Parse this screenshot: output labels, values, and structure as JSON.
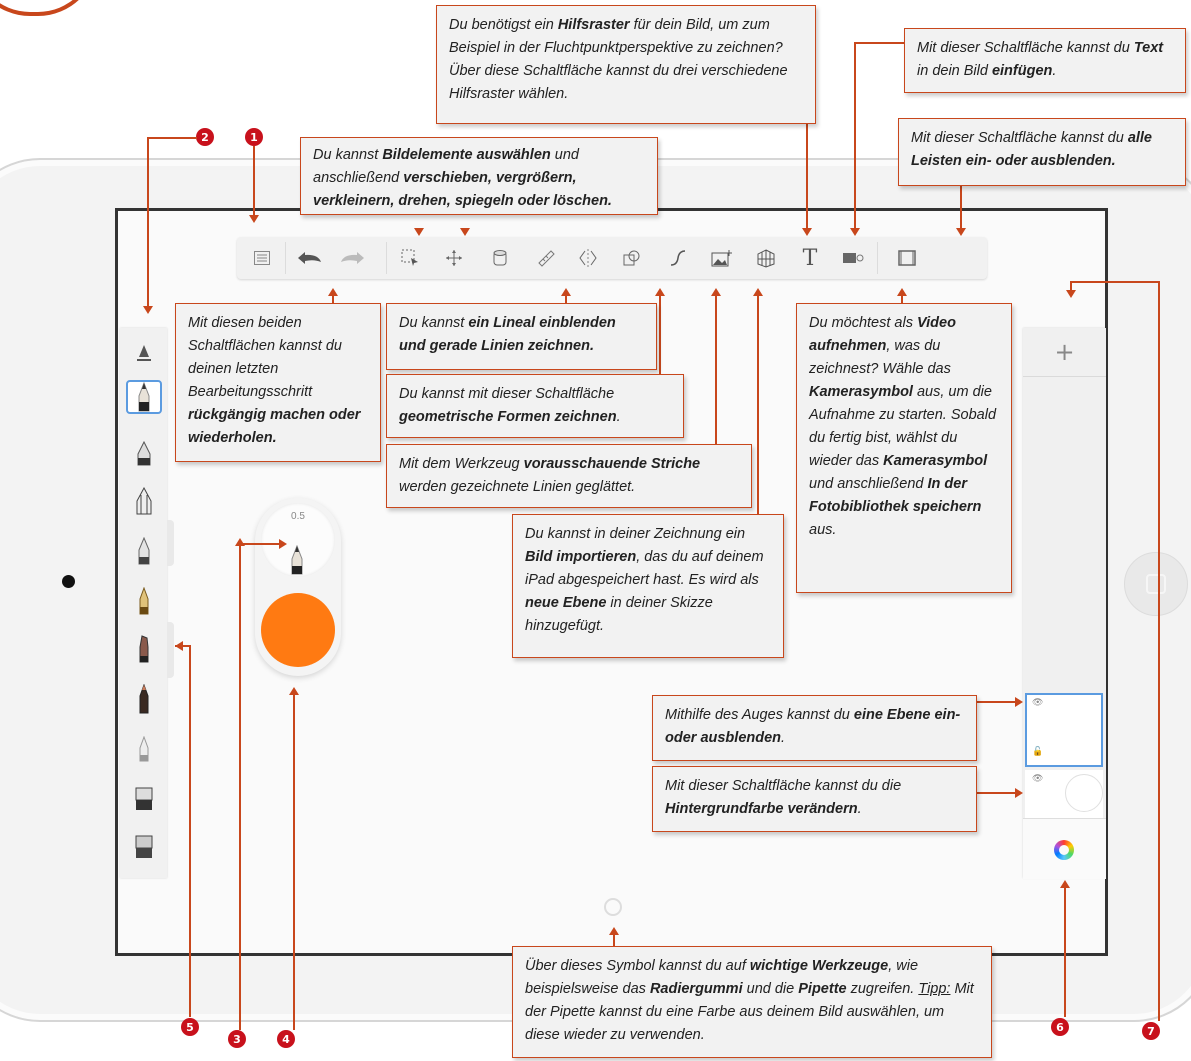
{
  "badges": {
    "b1": "1",
    "b2": "2",
    "b3": "3",
    "b4": "4",
    "b5": "5",
    "b6": "6",
    "b7": "7"
  },
  "toolbar": {
    "icons": [
      "list-icon",
      "undo-icon",
      "redo-icon",
      "select-icon",
      "transform-icon",
      "ruler-icon",
      "symmetry-icon",
      "shapes-icon",
      "predictive-stroke-icon",
      "import-image-icon",
      "perspective-grid-icon",
      "text-icon",
      "video-record-icon",
      "toggle-ui-icon"
    ],
    "text_glyph": "T"
  },
  "brush_size": "0.5",
  "layers": {
    "add_glyph": "+"
  },
  "accent_color": "#c8471c",
  "brush_color": "#ff7a12",
  "callouts": {
    "grid": {
      "p1": "Du benötigst ein ",
      "b1": "Hilfsraster",
      "p2": " für dein Bild, um zum Beispiel in der Fluchtpunktperspektive zu zeichnen? Über diese Schaltfläche kannst du drei verschiedene Hilfsraster wählen."
    },
    "text": {
      "p1": "Mit dieser Schaltfläche kannst du ",
      "b1": "Text",
      "p2": " in dein Bild ",
      "b2": "einfügen",
      "p3": "."
    },
    "toggle": {
      "p1": "Mit dieser Schaltfläche kannst du ",
      "b1": "alle Leisten ein- oder ausblenden."
    },
    "select": {
      "p1": "Du kannst ",
      "b1": "Bildelemente auswählen",
      "p2": " und anschließend ",
      "b2": "verschieben, vergrößern, verkleinern, drehen, spiegeln oder löschen."
    },
    "undo": {
      "p1": "Mit diesen beiden Schaltflächen kannst du deinen letzten Bearbeitungsschritt ",
      "b1": "rückgängig machen oder wiederholen."
    },
    "ruler": {
      "p1": "Du kannst ",
      "b1": "ein Lineal einblenden und gerade Linien zeichnen."
    },
    "shapes": {
      "p1": "Du kannst mit dieser Schaltfläche ",
      "b1": "geometrische Formen zeichnen",
      "p2": "."
    },
    "predictive": {
      "p1": "Mit dem Werkzeug ",
      "b1": "vorausschauende Striche",
      "p2": " werden gezeichnete Linien geglättet."
    },
    "import": {
      "p1": "Du kannst in deiner Zeichnung ein ",
      "b1": "Bild importieren",
      "p2": ", das du auf deinem iPad abgespeichert hast. Es wird als ",
      "b2": "neue Ebene",
      "p3": " in deiner Skizze hinzugefügt."
    },
    "video": {
      "p1": "Du möchtest als ",
      "b1": "Video aufnehmen",
      "p2": ", was du zeichnest? Wähle das ",
      "b2": "Kamerasymbol",
      "p3": " aus, um die Aufnahme zu starten. Sobald du fertig bist, wählst du wieder das ",
      "b3": "Kamerasymbol",
      "p4": " und anschließend ",
      "b4": "In der Fotobibliothek speichern",
      "p5": " aus."
    },
    "eye": {
      "p1": "Mithilfe des Auges kannst du ",
      "b1": "eine Ebene ein- oder ausblenden",
      "p2": "."
    },
    "background": {
      "p1": "Mit dieser Schaltfläche kannst du die ",
      "b1": "Hintergrundfarbe verändern",
      "p2": "."
    },
    "marking": {
      "p1": "Über dieses Symbol kannst du auf ",
      "b1": "wichtige Werkzeuge",
      "p2": ", wie beispielsweise das ",
      "b2": "Radiergummi",
      "p3": " und die ",
      "b3": "Pipette",
      "p4": " zugreifen. ",
      "u1": "Tipp:",
      "p5": " Mit der Pipette kannst du eine Farbe aus deinem Bild auswählen, um diese wieder zu verwenden."
    }
  }
}
